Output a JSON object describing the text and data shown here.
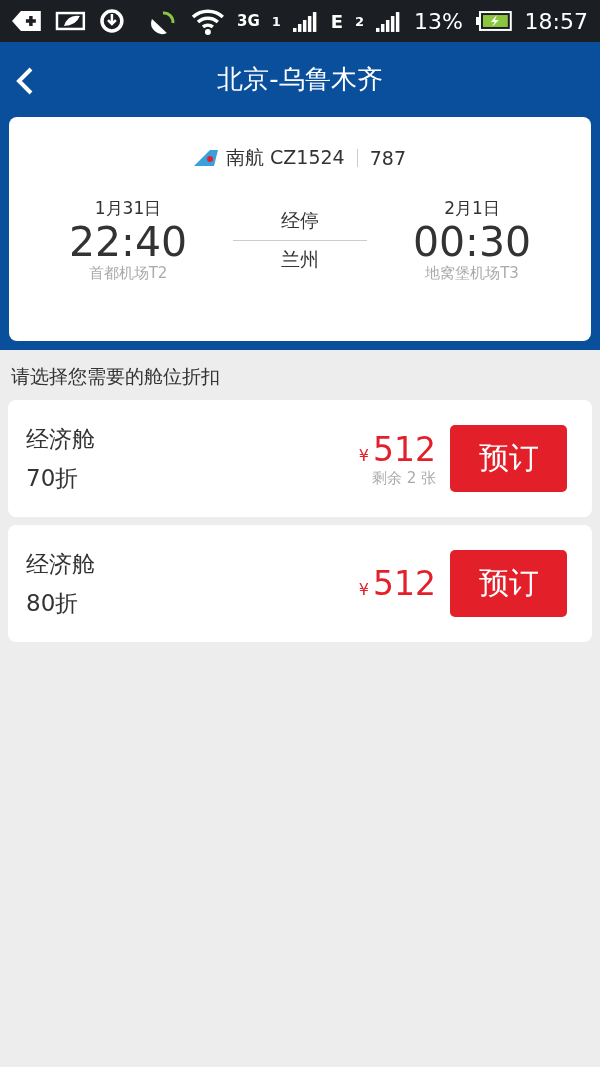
{
  "status_bar": {
    "network": "3G",
    "sim1": "1",
    "edge": "E",
    "sim2": "2",
    "battery": "13%",
    "time": "18:57"
  },
  "header": {
    "title": "北京-乌鲁木齐"
  },
  "flight": {
    "airline": "南航 CZ1524",
    "aircraft": "787",
    "departure": {
      "date": "1月31日",
      "time": "22:40",
      "airport": "首都机场T2"
    },
    "stop": {
      "label": "经停",
      "city": "兰州"
    },
    "arrival": {
      "date": "2月1日",
      "time": "00:30",
      "airport": "地窝堡机场T3"
    }
  },
  "section_title": "请选择您需要的舱位折扣",
  "fares": [
    {
      "cabin": "经济舱",
      "discount": "70折",
      "currency": "¥",
      "price": "512",
      "remaining": "剩余 2 张",
      "button": "预订"
    },
    {
      "cabin": "经济舱",
      "discount": "80折",
      "currency": "¥",
      "price": "512",
      "button": "预订"
    }
  ]
}
